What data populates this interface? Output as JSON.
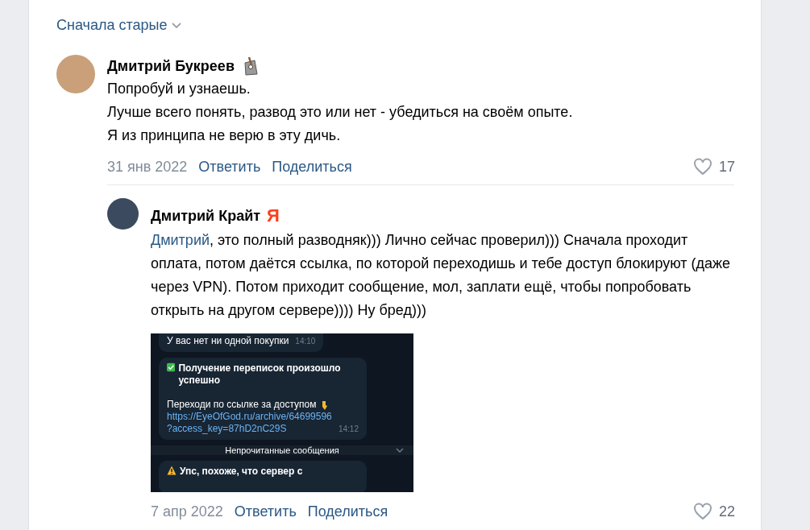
{
  "sort": {
    "label": "Сначала старые"
  },
  "comments": [
    {
      "author": "Дмитрий Букреев",
      "badge": {
        "kind": "sticker"
      },
      "text_lines": [
        "Попробуй и узнаешь.",
        "Лучше всего понять, развод это или нет - убедиться на своём опыте.",
        "Я из принципа не верю в эту дичь."
      ],
      "date": "31 янв 2022",
      "actions": [
        "Ответить",
        "Поделиться"
      ],
      "liked": false,
      "likes": "17",
      "replies": [
        {
          "author": "Дмитрий Крайт",
          "badge": {
            "kind": "letter",
            "text": "Я"
          },
          "mention": "Дмитрий",
          "text": ", это полный разводняк))) Лично сейчас проверил))) Сначала проходит оплата, потом даётся ссылка, по которой переходишь и тебе доступ блокируют (даже через VPN). Потом приходит сообщение, мол, заплати ещё, чтобы попробовать открыть на другом сервере)))) Ну бред)))",
          "image": {
            "messages": [
              {
                "kind": "plain",
                "lines": [
                  "У вас нет ни одной покупки"
                ],
                "time": "14:10"
              },
              {
                "kind": "success",
                "lines": [
                  "Получение переписок произошло успешно"
                ],
                "pointer": "Переходи по ссылке за доступом",
                "link_lines": [
                  "https://EyeOfGod.ru/archive/64699596",
                  "?access_key=87hD2nC29S"
                ],
                "time": "14:12"
              },
              {
                "kind": "divider",
                "lines": [
                  "Непрочитанные сообщения"
                ]
              },
              {
                "kind": "warning",
                "lines": [
                  "Упс, похоже, что сервер с"
                ]
              }
            ]
          },
          "date": "7 апр 2022",
          "actions": [
            "Ответить",
            "Поделиться"
          ],
          "liked": false,
          "likes": "22"
        }
      ]
    }
  ]
}
